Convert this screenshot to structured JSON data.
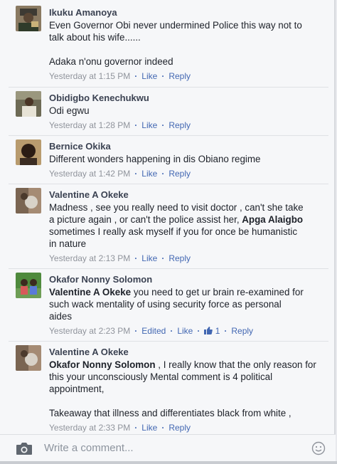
{
  "comments": [
    {
      "name": "Ikuku Amanoya",
      "text_lines": [
        "Even Governor Obi never undermined Police this way not to",
        "talk about his wife......"
      ],
      "text_lines_2": [
        "Adaka n'onu governor indeed"
      ],
      "time": "Yesterday at 1:15 PM",
      "like": "Like",
      "reply": "Reply"
    },
    {
      "name": "Obidigbo Kenechukwu",
      "text": "Odi egwu",
      "time": "Yesterday at 1:28 PM",
      "like": "Like",
      "reply": "Reply"
    },
    {
      "name": "Bernice Okika",
      "text": "Different wonders happening in dis Obiano regime",
      "time": "Yesterday at 1:42 PM",
      "like": "Like",
      "reply": "Reply"
    },
    {
      "name": "Valentine A Okeke",
      "line1": "Madness , see you really need to visit doctor , can't she take",
      "line2a": "a picture again , or can't the police assist her, ",
      "mention": "Apga Alaigbo",
      "line3": "sometimes I really ask myself if you for once be humanistic",
      "line4": "in nature",
      "time": "Yesterday at 2:13 PM",
      "like": "Like",
      "reply": "Reply"
    },
    {
      "name": "Okafor Nonny Solomon",
      "mention": "Valentine A Okeke",
      "line1_rest": " you need to get ur brain re-examined for",
      "line2": "such wack mentality of using security force as personal",
      "line3": "aides",
      "time": "Yesterday at 2:23 PM",
      "edited": "Edited",
      "like": "Like",
      "like_count": "1",
      "reply": "Reply"
    },
    {
      "name": "Valentine A Okeke",
      "mention": "Okafor Nonny Solomon",
      "line1_rest": " , I really know that the only reason for",
      "line2": "this your unconsciously Mental comment is 4 political",
      "line3": "appointment,",
      "line4": "Takeaway that illness and differentiates black from white ,",
      "time": "Yesterday at 2:33 PM",
      "like": "Like",
      "reply": "Reply"
    }
  ],
  "composer": {
    "placeholder": "Write a comment..."
  },
  "icons": [
    "camera-icon",
    "smiley-icon",
    "thumbs-up-icon"
  ],
  "colors": {
    "link": "#4267b2",
    "meta": "#90949c",
    "name": "#3b4252",
    "text": "#1d2129"
  }
}
